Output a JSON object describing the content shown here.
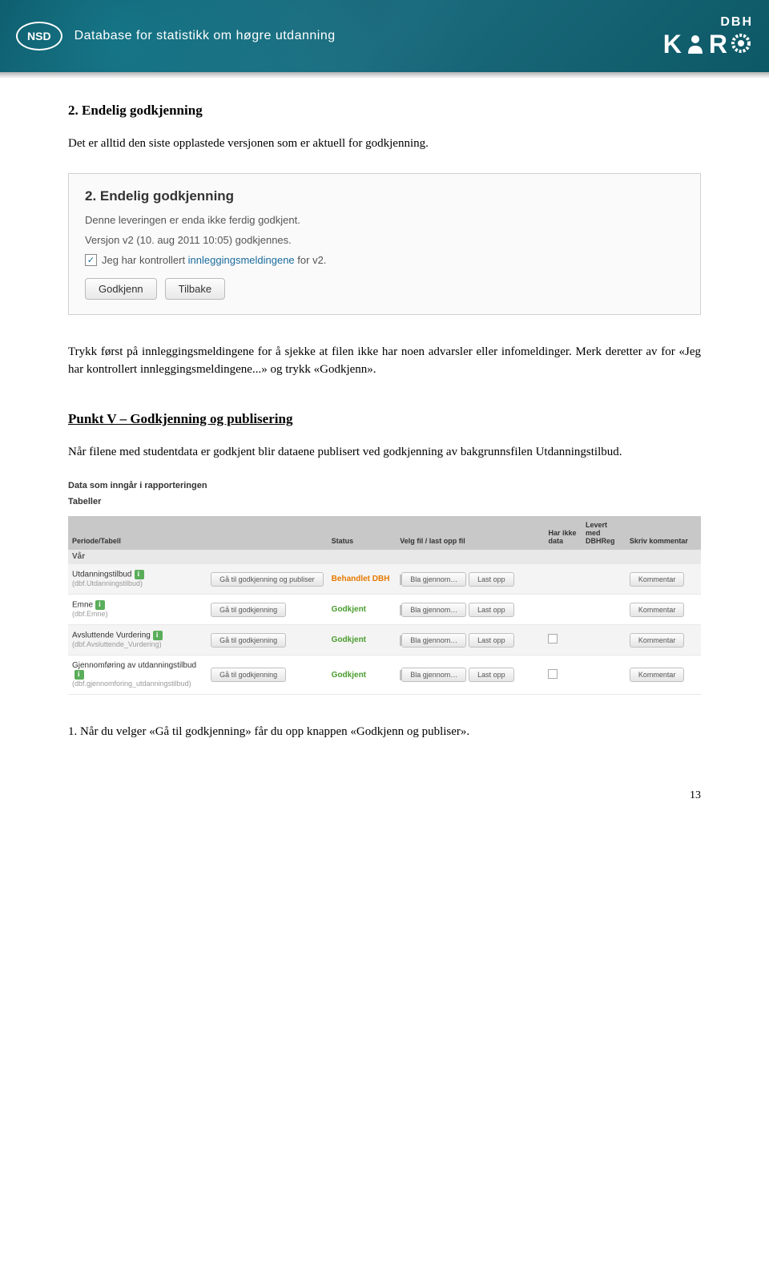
{
  "banner": {
    "logo": "NSD",
    "title": "Database for statistikk om høgre utdanning",
    "right_top": "DBH",
    "right_letters": [
      "K",
      "U",
      "R",
      "S"
    ]
  },
  "section2": {
    "title": "2. Endelig godkjenning",
    "intro": "Det er alltid den siste opplastede versjonen som er aktuell for godkjenning."
  },
  "ss1": {
    "title": "2. Endelig godkjenning",
    "l1": "Denne leveringen er enda ikke ferdig godkjent.",
    "l2": "Versjon v2 (10. aug 2011 10:05) godkjennes.",
    "check_pre": "Jeg har kontrollert ",
    "check_link": "innleggingsmeldingene",
    "check_post": " for v2.",
    "btn1": "Godkjenn",
    "btn2": "Tilbake"
  },
  "para2": "Trykk først på innleggingsmeldingene for å sjekke at filen ikke har noen advarsler eller infomeldinger. Merk deretter av for «Jeg har kontrollert innleggingsmeldingene...» og trykk «Godkjenn».",
  "punktV": {
    "title": "Punkt V – Godkjenning og publisering",
    "text": "Når filene med studentdata er godkjent blir dataene publisert ved godkjenning av bakgrunnsfilen Utdanningstilbud."
  },
  "table_ss": {
    "header1": "Data som inngår i rapporteringen",
    "header2": "Tabeller",
    "cols": {
      "c1": "Periode/Tabell",
      "c2": "Status",
      "c3": "Velg fil / last opp fil",
      "c4": "Har ikke data",
      "c5": "Levert med DBHReg",
      "c6": "Skriv kommentar"
    },
    "semester": "Vår",
    "rows": [
      {
        "name": "Utdanningstilbud",
        "sub": "(dbf.Utdanningstilbud)",
        "has_info": true,
        "go": "Gå til godkjenning og publiser",
        "status": "Behandlet DBH",
        "status_class": "status-orange",
        "browse": "Bla gjennom…",
        "upload": "Last opp",
        "cb": false,
        "comment": "Kommentar"
      },
      {
        "name": "Emne",
        "sub": "(dbf.Emne)",
        "has_info": true,
        "go": "Gå til godkjenning",
        "status": "Godkjent",
        "status_class": "status-green",
        "browse": "Bla gjennom…",
        "upload": "Last opp",
        "cb": false,
        "comment": "Kommentar"
      },
      {
        "name": "Avsluttende Vurdering",
        "sub": "(dbf.Avsluttende_Vurdering)",
        "has_info": true,
        "go": "Gå til godkjenning",
        "status": "Godkjent",
        "status_class": "status-green",
        "browse": "Bla gjennom…",
        "upload": "Last opp",
        "cb": true,
        "comment": "Kommentar"
      },
      {
        "name": "Gjennomføring av utdanningstilbud",
        "sub": "(dbf.gjennomforing_utdanningstilbud)",
        "has_info": true,
        "go": "Gå til godkjenning",
        "status": "Godkjent",
        "status_class": "status-green",
        "browse": "Bla gjennom…",
        "upload": "Last opp",
        "cb": true,
        "comment": "Kommentar"
      }
    ]
  },
  "final_para": "1. Når du velger «Gå til godkjenning» får du opp knappen «Godkjenn og publiser».",
  "page": "13"
}
